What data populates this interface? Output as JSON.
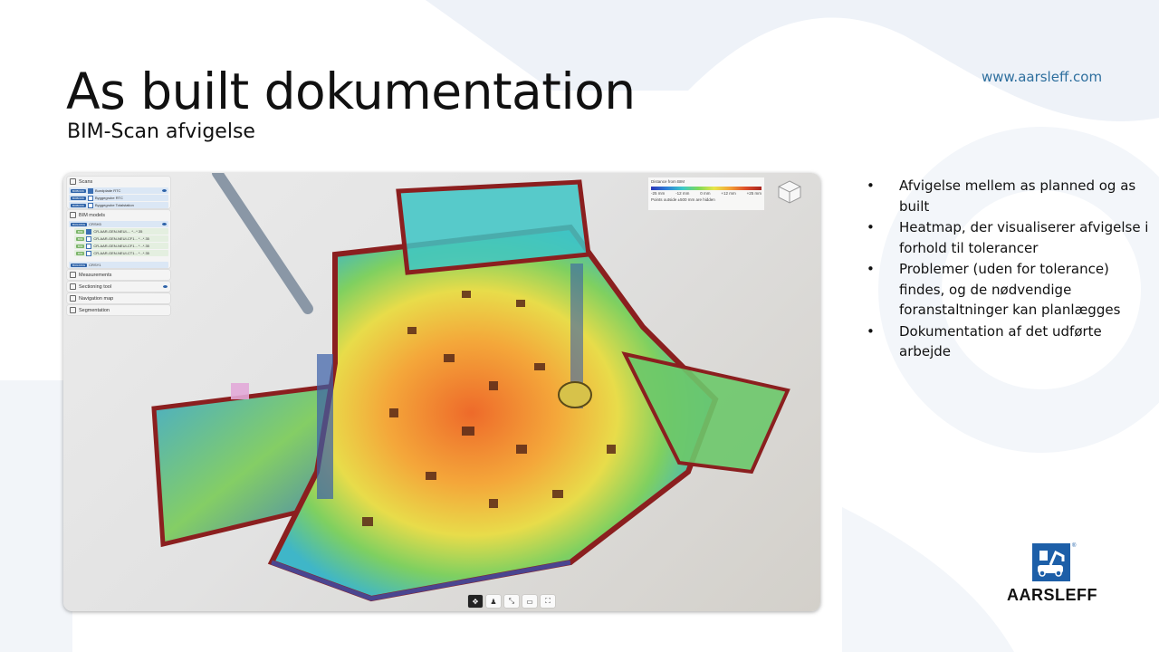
{
  "slide": {
    "title": "As built dokumentation",
    "subtitle": "BIM-Scan afvigelse",
    "url": "www.aarsleff.com",
    "logo_text": "AARSLEFF",
    "brand_color": "#1d5fa8"
  },
  "bullets": [
    "Afvigelse mellem as planned og as built",
    "Heatmap, der visualiserer afvigelse i forhold til tolerancer",
    "Problemer (uden for tolerance) findes, og de nødvendige foranstaltninger kan planlægges",
    "Dokumentation af det udførte arbejde"
  ],
  "viewer": {
    "sidebar": {
      "scans_label": "Scans",
      "scan_groups": [
        {
          "tag": "BOBOOK",
          "items": [
            "Bundplade RTC"
          ]
        },
        {
          "tag": "BOBOOK",
          "items": [
            "Byggegrube RTC",
            "Byggegrube Totalstation"
          ]
        }
      ],
      "bim_models_label": "BIM models",
      "building1_tag": "BUILDING",
      "building1_name": "CRSH3",
      "bim_tag": "BIM",
      "bim_items": [
        "CR-AAR-GEN-NEUI-...  *...*.35",
        "CR-AAR-GEN-NEUI-CF1...  *...*.35",
        "CR-AAR-GEN-NEUI-CF1...  *...*.35",
        "CR-AAR-GEN-NEUI-CT1...  *...*.35"
      ],
      "building2_tag": "BUILDING",
      "building2_name": "CRSY1",
      "tools": [
        "Measurements",
        "Sectioning tool",
        "Navigation map",
        "Segmentation"
      ]
    },
    "legend": {
      "title": "Distance from BIM",
      "ticks": [
        "-25 mm",
        "-12 mm",
        "0 mm",
        "+12 mm",
        "+25 mm"
      ],
      "note": "Points outside ±500 mm are hidden"
    },
    "toolbar_icons": [
      "move-icon",
      "person-icon",
      "measure-icon",
      "screen-icon",
      "fullscreen-icon"
    ]
  }
}
